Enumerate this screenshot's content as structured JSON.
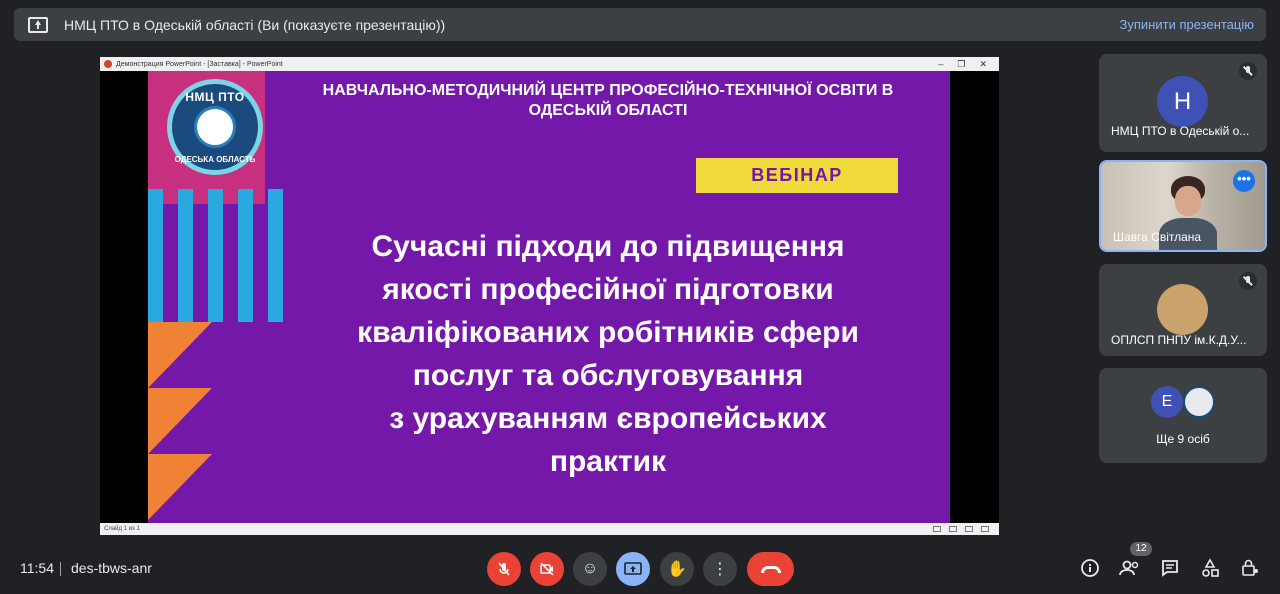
{
  "banner": {
    "title": "НМЦ ПТО в Одеській області (Ви (показуєте презентацію))",
    "stop_label": "Зупинити презентацію"
  },
  "ppt": {
    "window_title": "Демонстрация PowerPoint - [Заставка] - PowerPoint",
    "status": "Слайд 1 из 1"
  },
  "slide": {
    "logo_top": "НМЦ ПТО",
    "logo_bottom": "ОДЕСЬКА ОБЛАСТЬ",
    "header": "НАВЧАЛЬНО-МЕТОДИЧНИЙ ЦЕНТР ПРОФЕСІЙНО-ТЕХНІЧНОЇ ОСВІТИ В ОДЕСЬКІЙ ОБЛАСТІ",
    "badge": "ВЕБІНАР",
    "title_lines": [
      "Сучасні підходи до підвищення",
      "якості професійної підготовки",
      "кваліфікованих робітників сфери",
      "послуг та обслуговування",
      "з урахуванням європейських",
      "практик"
    ]
  },
  "participants": [
    {
      "initial": "Н",
      "name": "НМЦ ПТО в Одеській о...",
      "avatar_color": "#3f51b5"
    },
    {
      "name": "Шавга Світлана"
    },
    {
      "name": "ОПЛСП ПНПУ ім.К.Д.У..."
    },
    {
      "initial": "Е",
      "more_label": "Ще 9 осіб",
      "avatar_color": "#3f51b5"
    }
  ],
  "bottom": {
    "time": "11:54",
    "meeting_code": "des-tbws-anr",
    "people_count": "12"
  },
  "colors": {
    "accent": "#8ab4f8",
    "danger": "#ea4335",
    "slide_bg": "#7318a8",
    "badge_bg": "#f0d93a"
  }
}
